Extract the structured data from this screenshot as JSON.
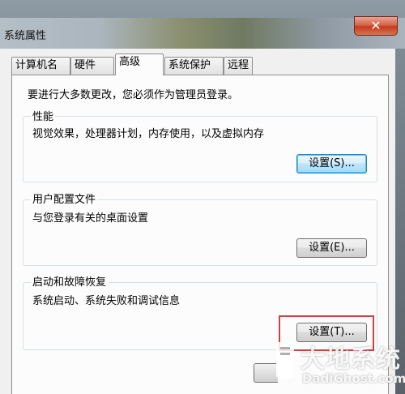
{
  "window": {
    "title": "系统属性",
    "close_glyph": "✕"
  },
  "tabs": [
    {
      "label": "计算机名",
      "active": false
    },
    {
      "label": "硬件",
      "active": false
    },
    {
      "label": "高级",
      "active": true
    },
    {
      "label": "系统保护",
      "active": false
    },
    {
      "label": "远程",
      "active": false
    }
  ],
  "notice": "要进行大多数更改，您必须作为管理员登录。",
  "groups": [
    {
      "label": "性能",
      "description": "视觉效果，处理器计划，内存使用，以及虚拟内存",
      "button": "设置(S)..."
    },
    {
      "label": "用户配置文件",
      "description": "与您登录有关的桌面设置",
      "button": "设置(E)..."
    },
    {
      "label": "启动和故障恢复",
      "description": "系统启动、系统失败和调试信息",
      "button": "设置(T)..."
    }
  ],
  "watermark": {
    "title": "大地系统",
    "subtitle": "DadiGhost.com"
  },
  "colors": {
    "highlight_border": "#c84545",
    "focused_button_border": "#3c7fb1"
  }
}
